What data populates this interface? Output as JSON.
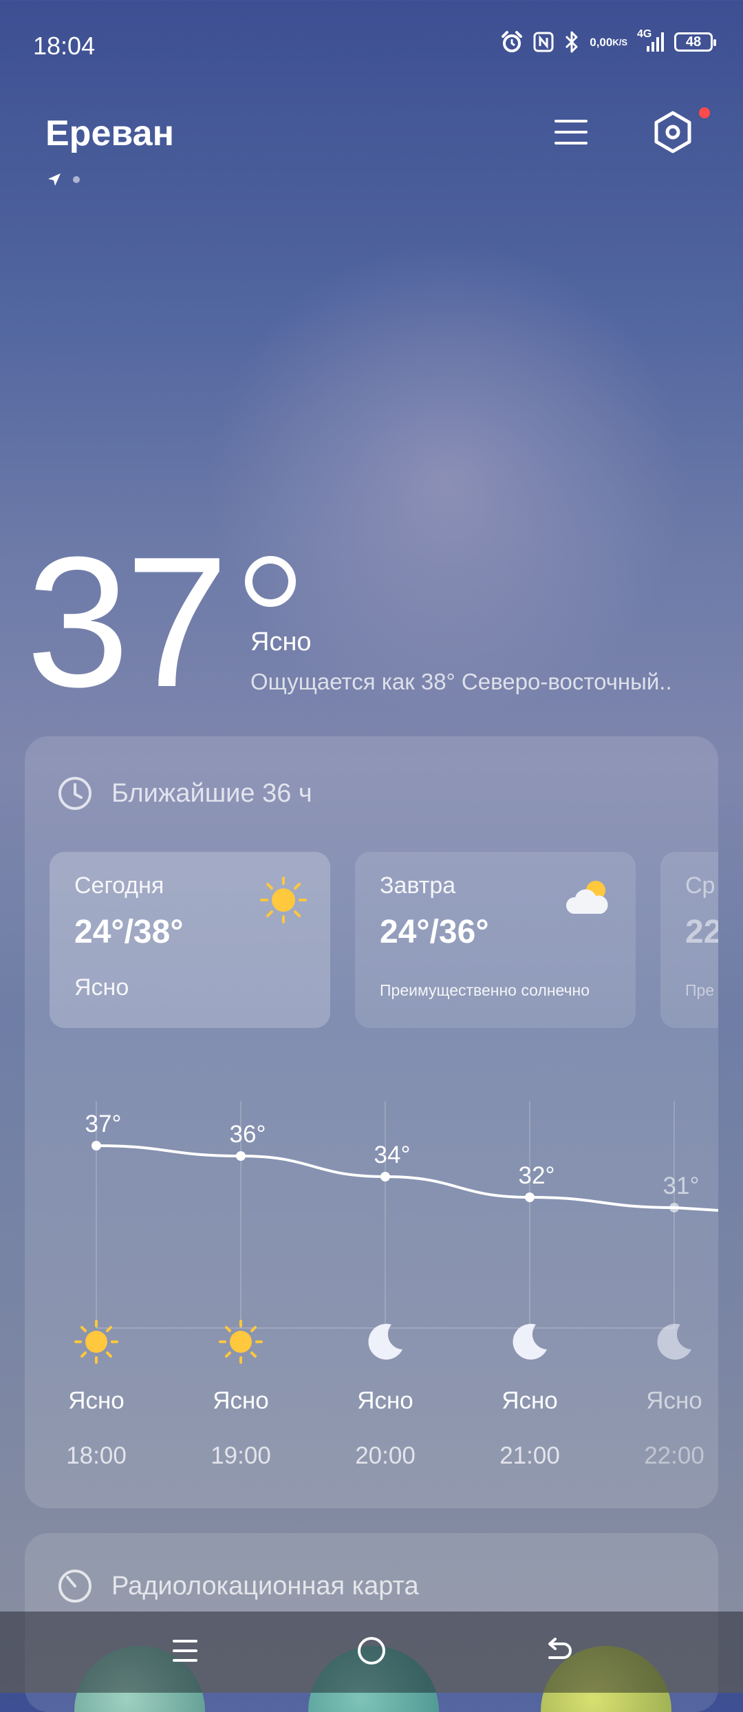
{
  "status_bar": {
    "time": "18:04",
    "net_speed_top": "0,00",
    "net_speed_bottom": "K/S",
    "network_type": "4G",
    "battery": "48"
  },
  "header": {
    "city": "Ереван",
    "menu_icon": "menu-icon",
    "settings_icon": "hexagon-settings-icon"
  },
  "current": {
    "temperature": "37",
    "condition": "Ясно",
    "feels_like": "Ощущается как 38° Северо-восточный.."
  },
  "forecast_card": {
    "title": "Ближайшие 36 ч",
    "days": [
      {
        "name": "Сегодня",
        "range": "24°/38°",
        "desc": "Ясно",
        "icon": "sun-icon"
      },
      {
        "name": "Завтра",
        "range": "24°/36°",
        "desc": "Преимущественно солнечно",
        "icon": "partly-cloudy-icon"
      },
      {
        "name": "Ср",
        "range": "22",
        "desc": "Пре",
        "icon": ""
      }
    ],
    "hourly": [
      {
        "time": "18:00",
        "temp": "37°",
        "cond": "Ясно",
        "icon": "sun-icon"
      },
      {
        "time": "19:00",
        "temp": "36°",
        "cond": "Ясно",
        "icon": "sun-icon"
      },
      {
        "time": "20:00",
        "temp": "34°",
        "cond": "Ясно",
        "icon": "moon-icon"
      },
      {
        "time": "21:00",
        "temp": "32°",
        "cond": "Ясно",
        "icon": "moon-icon"
      },
      {
        "time": "22:00",
        "temp": "31°",
        "cond": "Ясно",
        "icon": "moon-icon"
      }
    ]
  },
  "chart_data": {
    "type": "line",
    "x": [
      "18:00",
      "19:00",
      "20:00",
      "21:00",
      "22:00"
    ],
    "series": [
      {
        "values": [
          37,
          36,
          34,
          32,
          31
        ]
      }
    ],
    "grid": true
  },
  "radar_card": {
    "title": "Радиолокационная карта"
  },
  "colors": {
    "accent_red": "#ff4b4b",
    "sun": "#ffc83d"
  }
}
